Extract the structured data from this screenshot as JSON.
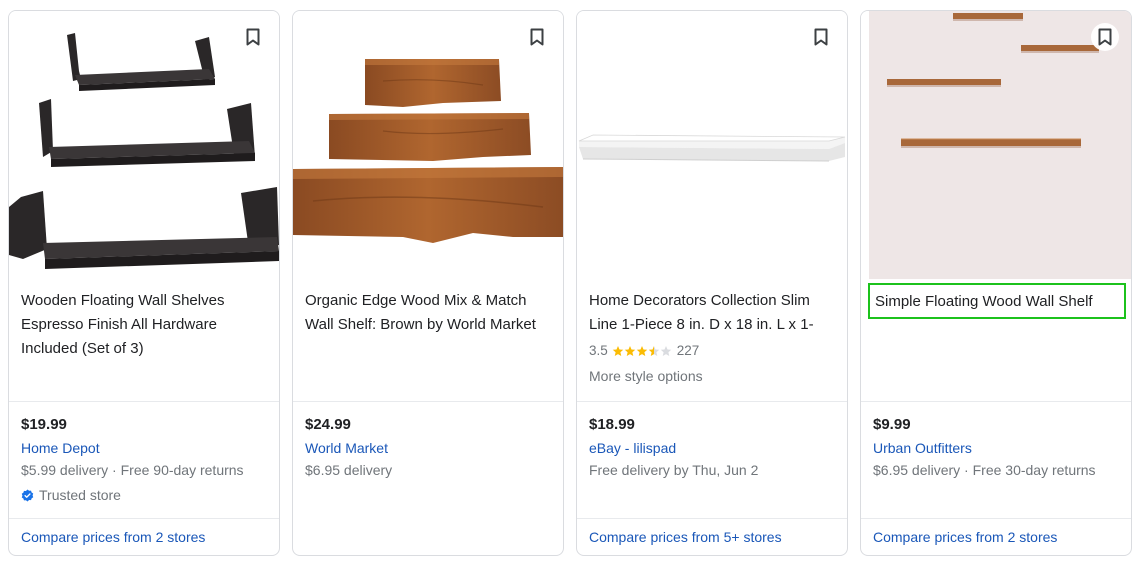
{
  "products": [
    {
      "title": "Wooden Floating Wall Shelves Espresso Finish All Hardware Included (Set of 3)",
      "price": "$19.99",
      "store": "Home Depot",
      "delivery": "$5.99 delivery · Free 90-day returns",
      "badge": "Trusted store",
      "compare": "Compare prices from 2 stores",
      "image": "black-u-shelves-set-of-3",
      "bookmark_icon": "bookmark-icon"
    },
    {
      "title": "Organic Edge Wood Mix & Match Wall Shelf: Brown by World Market",
      "price": "$24.99",
      "store": "World Market",
      "delivery": "$6.95 delivery",
      "image": "live-edge-wood-shelves",
      "bookmark_icon": "bookmark-icon"
    },
    {
      "title": "Home Decorators Collection Slim Line 1-Piece 8 in. D x 18 in. L x 1-",
      "rating": "3.5",
      "rating_stars": 3.5,
      "review_count": "227",
      "style_options": "More style options",
      "price": "$18.99",
      "store": "eBay - lilispad",
      "delivery": "Free delivery by Thu, Jun 2",
      "compare": "Compare prices from 5+ stores",
      "image": "white-slim-floating-shelf",
      "bookmark_icon": "bookmark-icon"
    },
    {
      "title": "Simple Floating Wood Wall Shelf",
      "price": "$9.99",
      "store": "Urban Outfitters",
      "delivery": "$6.95 delivery · Free 30-day returns",
      "compare": "Compare prices from 2 stores",
      "image": "wood-shelves-on-pink-wall",
      "bookmark_icon": "bookmark-icon"
    }
  ],
  "colors": {
    "link": "#1a57b8",
    "muted": "#70757a",
    "star": "#fbbc04",
    "highlight": "#1cc21c",
    "verified": "#1a73e8"
  }
}
